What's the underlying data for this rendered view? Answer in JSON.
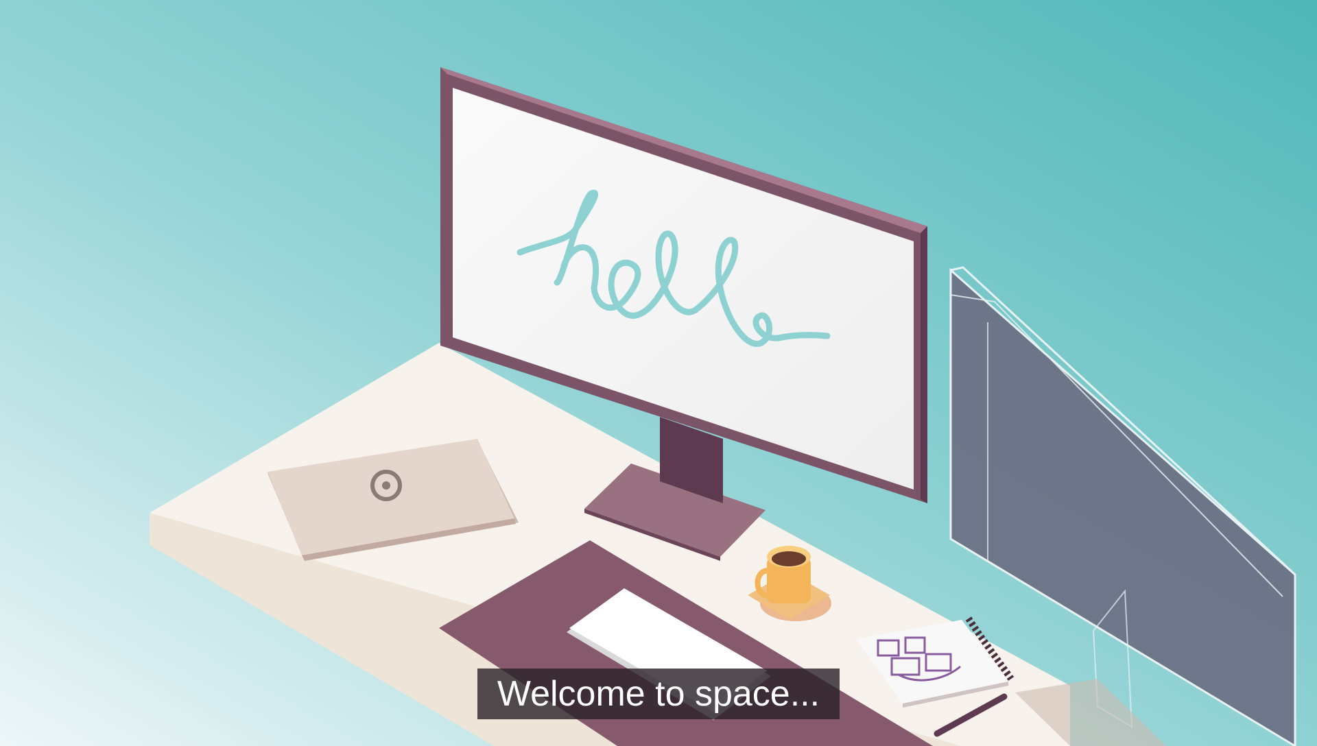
{
  "scene": {
    "monitor_screen_text": "hello",
    "caption": "Welcome to space..."
  },
  "colors": {
    "background_top_right": "#5dbfbe",
    "background_bottom_left": "#e8f3f5",
    "desk": "#f7f2ec",
    "monitor_frame": "#7b5468",
    "screen": "#f5f5f5",
    "hello_script": "#8ed1d3",
    "laptop": "#e4d5cd",
    "desk_mat": "#87596c",
    "mug": "#f3b45a",
    "holo_screen": "#6b6f82",
    "caption_bg": "#28202c"
  }
}
